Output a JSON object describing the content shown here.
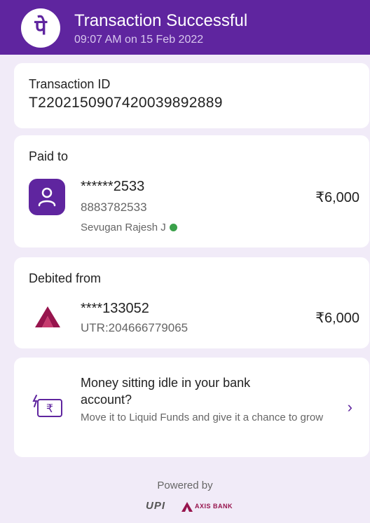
{
  "header": {
    "logo_glyph": "पे",
    "title": "Transaction Successful",
    "subtitle": "09:07 AM on 15 Feb 2022",
    "bg_color": "#5f259f"
  },
  "transaction": {
    "label": "Transaction ID",
    "id": "T2202150907420039892889"
  },
  "paid_to": {
    "label": "Paid to",
    "masked_account": "******2533",
    "phone": "8883782533",
    "name": "Sevugan Rajesh J",
    "verified": true,
    "amount": "₹6,000",
    "icon": "user-icon"
  },
  "debited_from": {
    "label": "Debited from",
    "masked_account": "****133052",
    "utr": "UTR:204666779065",
    "amount": "₹6,000",
    "icon": "axis-bank-icon"
  },
  "promo": {
    "title": "Money sitting idle in your bank account?",
    "description": "Move it to Liquid Funds and give it a chance to grow",
    "icon": "rupee-wallet-icon"
  },
  "footer": {
    "powered_by": "Powered by",
    "upi_label": "UPI",
    "bank_label": "AXIS BANK"
  }
}
